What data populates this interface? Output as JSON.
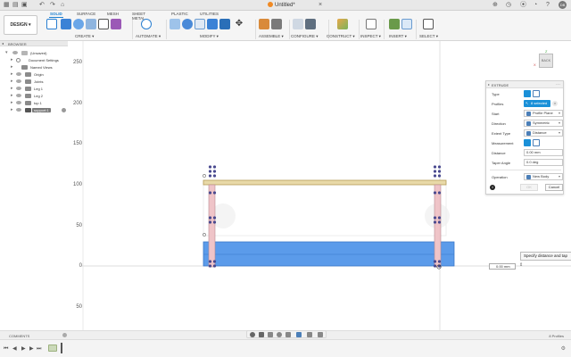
{
  "title_bar": {
    "doc_title": "Untitled*"
  },
  "toolbar": {
    "design_label": "DESIGN",
    "tabs": [
      "SOLID",
      "SURFACE",
      "MESH",
      "SHEET METAL",
      "PLASTIC",
      "UTILITIES"
    ],
    "active_tab": "SOLID",
    "groups": [
      "CREATE",
      "AUTOMATE",
      "MODIFY",
      "ASSEMBLE",
      "CONFIGURE",
      "CONSTRUCT",
      "INSPECT",
      "INSERT",
      "SELECT"
    ]
  },
  "browser": {
    "title": "BROWSER",
    "items": [
      {
        "label": "(Unsaved)"
      },
      {
        "label": "Document Settings"
      },
      {
        "label": "Named Views"
      },
      {
        "label": "Origin"
      },
      {
        "label": "Joints"
      },
      {
        "label": "Leg 1"
      },
      {
        "label": "Leg 2"
      },
      {
        "label": "top 1"
      },
      {
        "label": "support:1"
      }
    ]
  },
  "viewport": {
    "axis_labels": [
      "250",
      "200",
      "150",
      "100",
      "50",
      "0",
      "50"
    ],
    "viewcube_face": "BACK",
    "viewcube_axis_z": "Z",
    "viewcube_axis_x": "X"
  },
  "extrude_panel": {
    "title": "EXTRUDE",
    "rows": {
      "type": "Type",
      "profiles_label": "Profiles",
      "profiles_value": "8 selected",
      "start_label": "Start",
      "start_value": "Profile Plane",
      "direction_label": "Direction",
      "direction_value": "Symmetric",
      "extent_label": "Extent Type",
      "extent_value": "Distance",
      "measurement_label": "Measurement",
      "distance_label": "Distance",
      "distance_value": "0.00 mm",
      "taper_label": "Taper Angle",
      "taper_value": "0.0 deg",
      "operation_label": "Operation",
      "operation_value": "New Body"
    },
    "ok_label": "OK",
    "cancel_label": "Cancel"
  },
  "tooltip_text": "Specify distance and tap",
  "distance_input_value": "0.00 mm",
  "comments": {
    "label": "COMMENTS",
    "profiles_count": "8 Profiles"
  },
  "colors": {
    "accent": "#1a90d8",
    "body_blue": "#5b9bea",
    "top_board": "#e8d9a8",
    "leg_pink": "#efc4c8",
    "point_purple": "#4a4a8f"
  }
}
